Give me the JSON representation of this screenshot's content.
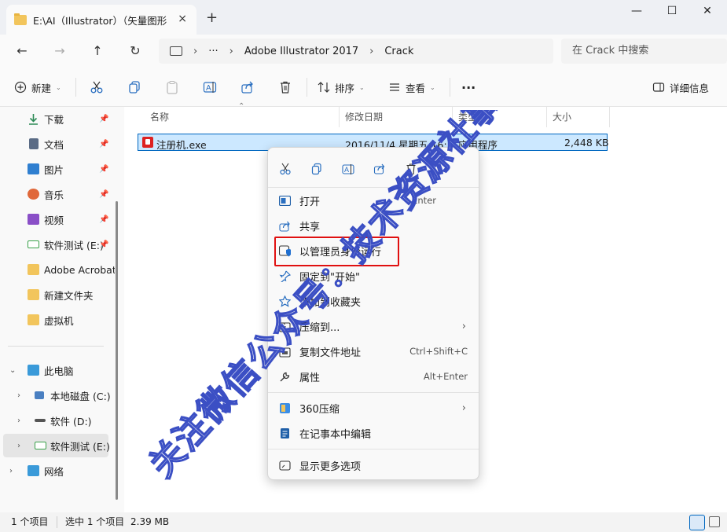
{
  "tab": {
    "title": "E:\\AI（Illustrator）（矢量图形",
    "close": "×",
    "new": "+"
  },
  "window": {
    "minimize": "—",
    "maximize": "☐",
    "close": "✕"
  },
  "address": {
    "root_more": "···",
    "crumbs": [
      "Adobe Illustrator 2017",
      "Crack"
    ],
    "search_placeholder": "在 Crack 中搜索"
  },
  "toolbar": {
    "new_label": "新建",
    "sort_label": "排序",
    "view_label": "查看",
    "more": "···",
    "details_label": "详细信息"
  },
  "sidebar": {
    "quick": [
      {
        "label": "下载",
        "icon": "download-icon",
        "color": "#2e8b57"
      },
      {
        "label": "文档",
        "icon": "document-icon",
        "color": "#5a6b85"
      },
      {
        "label": "图片",
        "icon": "picture-icon",
        "color": "#2f7fd0"
      },
      {
        "label": "音乐",
        "icon": "music-icon",
        "color": "#e0683a"
      },
      {
        "label": "视频",
        "icon": "video-icon",
        "color": "#8a4fc7"
      },
      {
        "label": "软件测试 (E:)",
        "icon": "drive-icon",
        "color": "#3aa14a"
      },
      {
        "label": "Adobe Acrobat",
        "icon": "folder-icon",
        "color": "#f2c55c"
      },
      {
        "label": "新建文件夹",
        "icon": "folder-icon",
        "color": "#f2c55c"
      },
      {
        "label": "虚拟机",
        "icon": "folder-icon",
        "color": "#f2c55c"
      }
    ],
    "this_pc": "此电脑",
    "drives": [
      {
        "label": "本地磁盘 (C:)",
        "icon": "windows-drive-icon"
      },
      {
        "label": "软件 (D:)",
        "icon": "drive-icon"
      },
      {
        "label": "软件测试 (E:)",
        "icon": "drive-icon"
      }
    ],
    "network": "网络"
  },
  "columns": {
    "name": "名称",
    "date": "修改日期",
    "type": "类型",
    "size": "大小"
  },
  "files": [
    {
      "name": "注册机.exe",
      "date": "2016/11/4 星期五 16:...",
      "type": "应用程序",
      "size": "2,448 KB"
    }
  ],
  "context_menu": {
    "items": [
      {
        "label": "打开",
        "shortcut": "Enter",
        "icon": "open-icon"
      },
      {
        "label": "共享",
        "shortcut": "",
        "icon": "share-icon"
      },
      {
        "label": "以管理员身份运行",
        "shortcut": "",
        "icon": "shield-icon"
      },
      {
        "label": "固定到\"开始\"",
        "shortcut": "",
        "icon": "pin-icon"
      },
      {
        "label": "添加到收藏夹",
        "shortcut": "",
        "icon": "star-icon"
      },
      {
        "label": "压缩到...",
        "shortcut": "",
        "icon": "zip-icon"
      },
      {
        "label": "复制文件地址",
        "shortcut": "Ctrl+Shift+C",
        "icon": "copy-path-icon"
      },
      {
        "label": "属性",
        "shortcut": "Alt+Enter",
        "icon": "wrench-icon"
      },
      {
        "label": "360压缩",
        "shortcut": "",
        "icon": "360-zip-icon"
      },
      {
        "label": "在记事本中编辑",
        "shortcut": "",
        "icon": "notepad-icon"
      },
      {
        "label": "显示更多选项",
        "shortcut": "",
        "icon": "more-options-icon"
      }
    ]
  },
  "status": {
    "count": "1 个项目",
    "selected": "选中 1 个项目",
    "size": "2.39 MB"
  },
  "watermark": {
    "text": "关注微信公众号：技术资源社事务"
  },
  "colors": {
    "accent": "#0067c0",
    "highlight_box": "#e01010",
    "selection_bg": "#cce8ff",
    "watermark": "#3b4fc4"
  }
}
